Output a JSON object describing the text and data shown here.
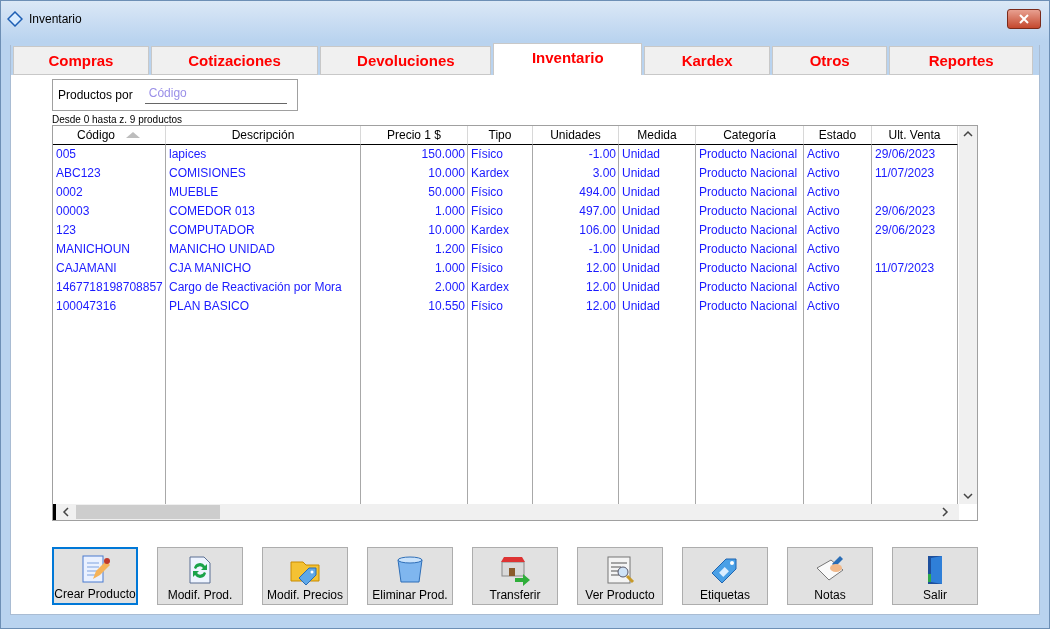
{
  "window": {
    "title": "Inventario"
  },
  "tabs": [
    {
      "label": "Compras",
      "selected": false
    },
    {
      "label": "Cotizaciones",
      "selected": false
    },
    {
      "label": "Devoluciones",
      "selected": false
    },
    {
      "label": "Inventario",
      "selected": true
    },
    {
      "label": "Kardex",
      "selected": false
    },
    {
      "label": "Otros",
      "selected": false
    },
    {
      "label": "Reportes",
      "selected": false
    }
  ],
  "filter": {
    "label": "Productos por",
    "placeholder": "Código"
  },
  "range_text": "Desde 0 hasta z. 9 productos",
  "table": {
    "columns": [
      {
        "label": "Código",
        "sorted": true
      },
      {
        "label": "Descripción",
        "sorted": false
      },
      {
        "label": "Precio 1 $",
        "sorted": false
      },
      {
        "label": "Tipo",
        "sorted": false
      },
      {
        "label": "Unidades",
        "sorted": false
      },
      {
        "label": "Medida",
        "sorted": false
      },
      {
        "label": "Categoría",
        "sorted": false
      },
      {
        "label": "Estado",
        "sorted": false
      },
      {
        "label": "Ult. Venta",
        "sorted": false
      }
    ],
    "rows": [
      [
        "005",
        "lapices",
        "150.000",
        "Físico",
        "-1.00",
        "Unidad",
        "Producto Nacional",
        "Activo",
        "29/06/2023"
      ],
      [
        "ABC123",
        "COMISIONES",
        "10.000",
        "Kardex",
        "3.00",
        "Unidad",
        "Producto Nacional",
        "Activo",
        "11/07/2023"
      ],
      [
        "0002",
        "MUEBLE",
        "50.000",
        "Físico",
        "494.00",
        "Unidad",
        "Producto Nacional",
        "Activo",
        ""
      ],
      [
        "00003",
        "COMEDOR 013",
        "1.000",
        "Físico",
        "497.00",
        "Unidad",
        "Producto Nacional",
        "Activo",
        "29/06/2023"
      ],
      [
        "123",
        "COMPUTADOR",
        "10.000",
        "Kardex",
        "106.00",
        "Unidad",
        "Producto Nacional",
        "Activo",
        "29/06/2023"
      ],
      [
        "MANICHOUN",
        "MANICHO UNIDAD",
        "1.200",
        "Físico",
        "-1.00",
        "Unidad",
        "Producto Nacional",
        "Activo",
        ""
      ],
      [
        "CAJAMANI",
        "CJA MANICHO",
        "1.000",
        "Físico",
        "12.00",
        "Unidad",
        "Producto Nacional",
        "Activo",
        "11/07/2023"
      ],
      [
        "1467718198708857",
        "Cargo de Reactivación por Mora",
        "2.000",
        "Kardex",
        "12.00",
        "Unidad",
        "Producto Nacional",
        "Activo",
        ""
      ],
      [
        "100047316",
        "PLAN BASICO",
        "10.550",
        "Físico",
        "12.00",
        "Unidad",
        "Producto Nacional",
        "Activo",
        ""
      ]
    ]
  },
  "buttons": [
    {
      "label": "Crear Producto",
      "kind": "create",
      "focused": true
    },
    {
      "label": "Modif. Prod.",
      "kind": "modify",
      "focused": false
    },
    {
      "label": "Modif. Precios",
      "kind": "prices",
      "focused": false
    },
    {
      "label": "Eliminar Prod.",
      "kind": "delete",
      "focused": false
    },
    {
      "label": "Transferir",
      "kind": "transfer",
      "focused": false
    },
    {
      "label": "Ver Producto",
      "kind": "view",
      "focused": false
    },
    {
      "label": "Etiquetas",
      "kind": "tags",
      "focused": false
    },
    {
      "label": "Notas",
      "kind": "notes",
      "focused": false
    },
    {
      "label": "Salir",
      "kind": "exit",
      "focused": false
    }
  ]
}
